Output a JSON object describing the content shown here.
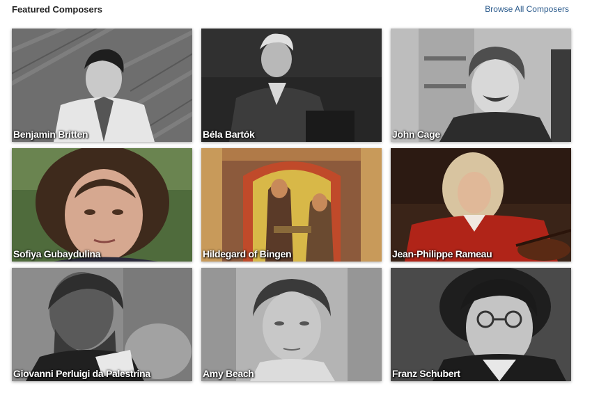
{
  "header": {
    "title": "Featured Composers",
    "browse_label": "Browse All Composers"
  },
  "composers": [
    {
      "name": "Benjamin Britten"
    },
    {
      "name": "Béla Bartók"
    },
    {
      "name": "John Cage"
    },
    {
      "name": "Sofiya Gubaydulina"
    },
    {
      "name": "Hildegard of Bingen"
    },
    {
      "name": "Jean-Philippe Rameau"
    },
    {
      "name": "Giovanni Perluigi da Palestrina"
    },
    {
      "name": "Amy Beach"
    },
    {
      "name": "Franz Schubert"
    }
  ]
}
